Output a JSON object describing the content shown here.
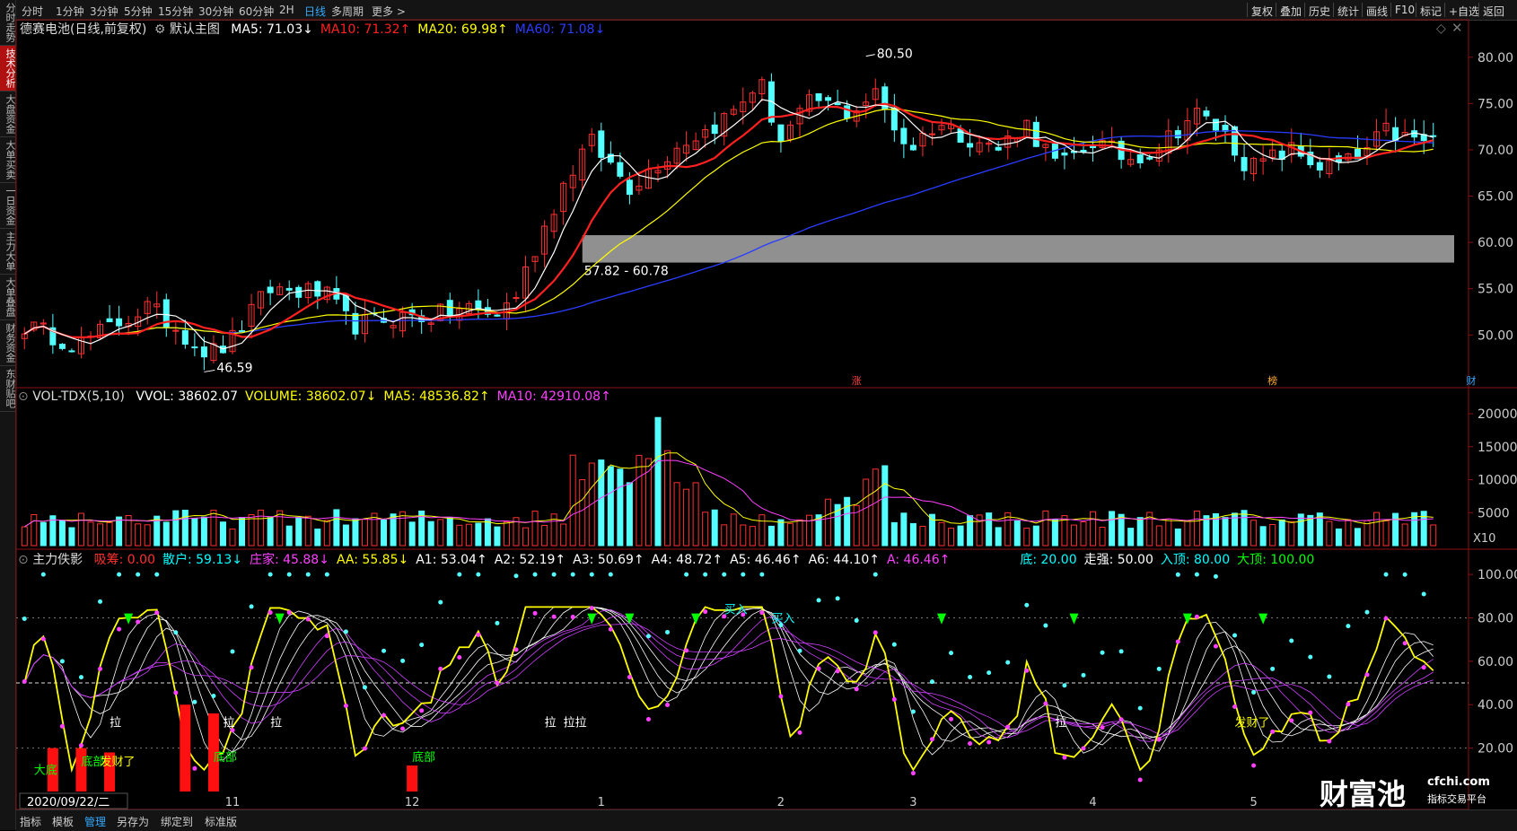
{
  "left_tabs": [
    {
      "label": "分时走势",
      "active": false
    },
    {
      "label": "技术分析",
      "active": true
    },
    {
      "label": "大盘资金",
      "active": false
    },
    {
      "label": "大单买卖",
      "active": false
    },
    {
      "label": "一日资金",
      "active": false
    },
    {
      "label": "主力大单",
      "active": false
    },
    {
      "label": "大单叠盘",
      "active": false
    },
    {
      "label": "财务资金",
      "active": false
    },
    {
      "label": "东财贴吧",
      "active": false
    }
  ],
  "periods": [
    "分时",
    "1分钟",
    "3分钟",
    "5分钟",
    "15分钟",
    "30分钟",
    "60分钟",
    "2H",
    "日线",
    "多周期",
    "更多 >"
  ],
  "active_period": "日线",
  "right_tools": [
    "复权",
    "叠加",
    "历史",
    "统计",
    "画线",
    "F10",
    "标记",
    "+自选",
    "返回"
  ],
  "main": {
    "stock": "德赛电池(日线,前复权)",
    "template": "默认主图",
    "ma": [
      {
        "label": "MA5: 71.03↓",
        "color": "#ffffff"
      },
      {
        "label": "MA10: 71.32↑",
        "color": "#ff2020"
      },
      {
        "label": "MA20: 69.98↑",
        "color": "#ffff00"
      },
      {
        "label": "MA60: 71.08↓",
        "color": "#2a3cff"
      }
    ],
    "high_label": "80.50",
    "low_label": "46.59",
    "zone_label": "57.82 - 60.78",
    "events": [
      {
        "label": "涨",
        "color": "#ff4040"
      },
      {
        "label": "榜",
        "color": "#ffaa33"
      },
      {
        "label": "财",
        "color": "#33aaff"
      }
    ]
  },
  "vol": {
    "title": "VOL-TDX(5,10)",
    "items": [
      {
        "label": "VVOL: 38602.07",
        "color": "#ffffff"
      },
      {
        "label": "VOLUME: 38602.07↓",
        "color": "#ffff00"
      },
      {
        "label": "MA5: 48536.82↑",
        "color": "#ffff00"
      },
      {
        "label": "MA10: 42910.08↑",
        "color": "#ff40ff"
      }
    ],
    "unit": "X10"
  },
  "ind": {
    "title": "主力佚影",
    "items": [
      {
        "label": "吸筹: 0.00",
        "color": "#ff3030"
      },
      {
        "label": "散户: 59.13↓",
        "color": "#00ffff"
      },
      {
        "label": "庄家: 45.88↓",
        "color": "#ff40ff"
      },
      {
        "label": "AA: 55.85↓",
        "color": "#ffff00"
      },
      {
        "label": "A1: 53.04↑",
        "color": "#ffffff"
      },
      {
        "label": "A2: 52.19↑",
        "color": "#ffffff"
      },
      {
        "label": "A3: 50.69↑",
        "color": "#ffffff"
      },
      {
        "label": "A4: 48.72↑",
        "color": "#ffffff"
      },
      {
        "label": "A5: 46.46↑",
        "color": "#ffffff"
      },
      {
        "label": "A6: 44.10↑",
        "color": "#ffffff"
      },
      {
        "label": "A: 46.46↑",
        "color": "#ff40ff"
      }
    ],
    "items2": [
      {
        "label": "底: 20.00",
        "color": "#00ffff"
      },
      {
        "label": "走强: 50.00",
        "color": "#ffffff"
      },
      {
        "label": "入顶: 80.00",
        "color": "#00ffff"
      },
      {
        "label": "大顶: 100.00",
        "color": "#00ff00"
      }
    ],
    "annotations": [
      {
        "text": "大底",
        "color": "#00ff00"
      },
      {
        "text": "底部",
        "color": "#00ff00"
      },
      {
        "text": "发财了",
        "color": "#ffff00"
      },
      {
        "text": "拉",
        "color": "#ffffff"
      },
      {
        "text": "拉",
        "color": "#ffffff"
      },
      {
        "text": "拉",
        "color": "#ffffff"
      },
      {
        "text": "底部",
        "color": "#00ff00"
      },
      {
        "text": "底部",
        "color": "#00ff00"
      },
      {
        "text": "拉",
        "color": "#ffffff"
      },
      {
        "text": "拉拉",
        "color": "#ffffff"
      },
      {
        "text": "买入",
        "color": "#00ffff"
      },
      {
        "text": "买入",
        "color": "#00ffff"
      },
      {
        "text": "拉",
        "color": "#ffffff"
      },
      {
        "text": "发财了",
        "color": "#ffff00"
      }
    ]
  },
  "date_cursor": "2020/09/22/二",
  "months": [
    "2",
    "11",
    "12",
    "1",
    "2",
    "3",
    "4",
    "5"
  ],
  "bottom_tabs": [
    "指标",
    "模板",
    "管理",
    "另存为",
    "绑定到",
    "标准版"
  ],
  "active_bottom": "管理",
  "logo": {
    "name": "财富池",
    "url": "cfchi.com",
    "sub": "指标交易平台"
  },
  "chart_data": [
    {
      "type": "candlestick",
      "title": "德赛电池(日线,前复权)",
      "y_ticks": [
        50.0,
        55.0,
        60.0,
        65.0,
        70.0,
        75.0,
        80.0
      ],
      "ylim": [
        44.5,
        82.5
      ],
      "high": 80.5,
      "low": 46.59,
      "zone": [
        57.82,
        60.78
      ],
      "ma_last": {
        "MA5": 71.03,
        "MA10": 71.32,
        "MA20": 69.98,
        "MA60": 71.08
      }
    },
    {
      "type": "bar",
      "title": "VOL-TDX(5,10)",
      "y_ticks": [
        5000,
        10000,
        15000,
        20000
      ],
      "ylim": [
        0,
        21500
      ],
      "last": {
        "VVOL": 38602.07,
        "MA5": 48536.82,
        "MA10": 42910.08
      }
    },
    {
      "type": "line",
      "title": "主力佚影",
      "y_ticks": [
        20.0,
        40.0,
        60.0,
        80.0,
        100.0
      ],
      "ylim": [
        0,
        105
      ],
      "last": {
        "散户": 59.13,
        "庄家": 45.88,
        "AA": 55.85,
        "A1": 53.04,
        "A2": 52.19,
        "A3": 50.69,
        "A4": 48.72,
        "A5": 46.46,
        "A6": 44.1,
        "A": 46.46
      }
    }
  ]
}
